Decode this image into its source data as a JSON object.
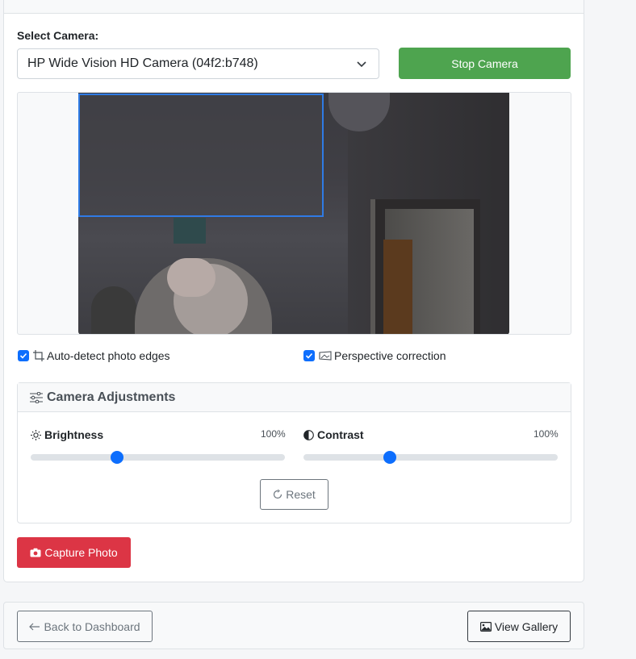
{
  "camera": {
    "label": "Select Camera:",
    "selected": "HP Wide Vision HD Camera (04f2:b748)",
    "stop_label": "Stop Camera"
  },
  "options": {
    "auto_detect": {
      "label": "Auto-detect photo edges",
      "checked": true
    },
    "perspective": {
      "label": "Perspective correction",
      "checked": true
    }
  },
  "adjustments": {
    "title": "Camera Adjustments",
    "brightness": {
      "label": "Brightness",
      "value_text": "100%",
      "level": 0.34
    },
    "contrast": {
      "label": "Contrast",
      "value_text": "100%",
      "level": 0.34
    },
    "reset_label": "Reset"
  },
  "capture": {
    "label": "Capture Photo"
  },
  "footer": {
    "back_label": "Back to Dashboard",
    "gallery_label": "View Gallery"
  },
  "colors": {
    "primary": "#0d6efd",
    "success": "#4ea44f",
    "danger": "#dc3545",
    "detect_outline": "#2f7be5"
  },
  "icons": [
    "chevron-down-icon",
    "crop-icon",
    "perspective-icon",
    "sliders-icon",
    "sun-icon",
    "contrast-icon",
    "reset-icon",
    "camera-icon",
    "arrow-left-icon",
    "image-icon",
    "check-icon"
  ]
}
